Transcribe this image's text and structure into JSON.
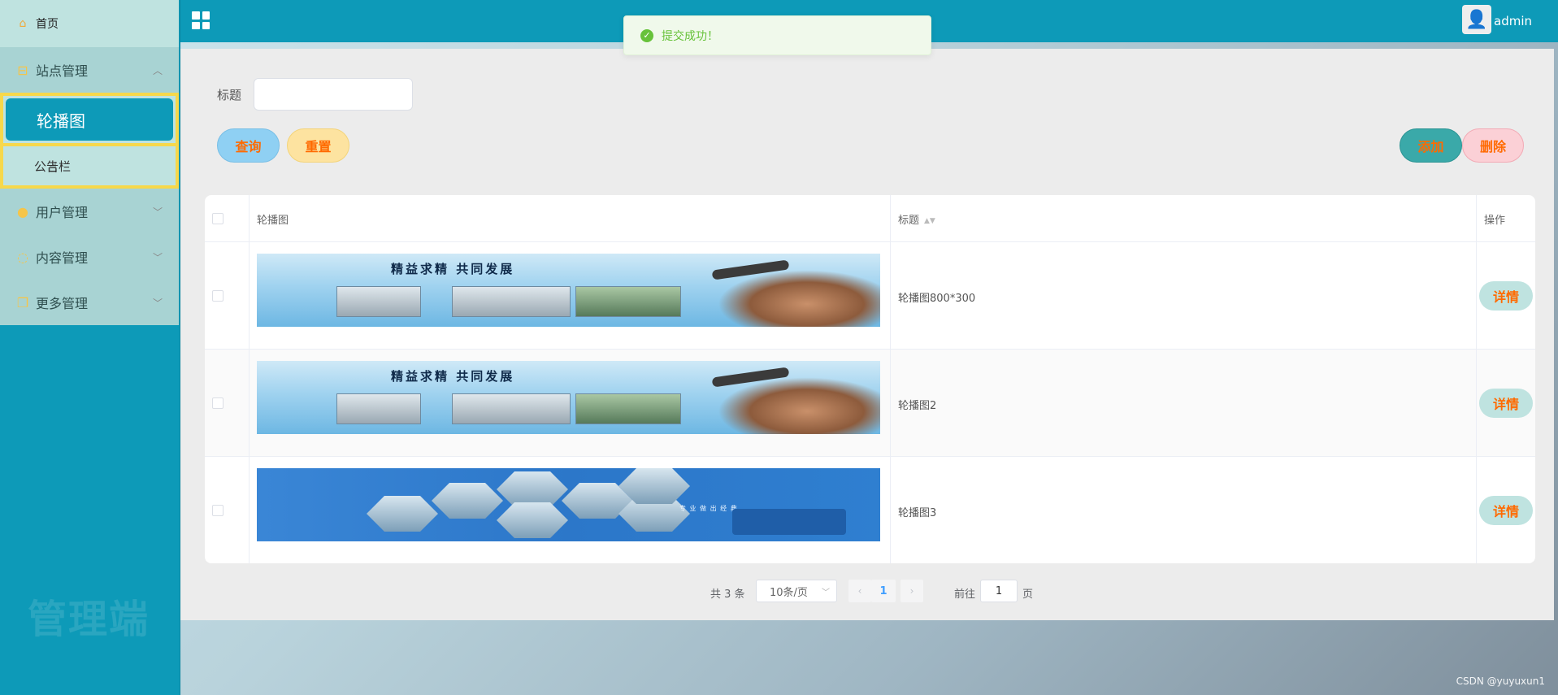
{
  "sidebar": {
    "home": "首页",
    "groups": [
      {
        "label": "站点管理",
        "expanded": true
      },
      {
        "label": "用户管理"
      },
      {
        "label": "内容管理"
      },
      {
        "label": "更多管理"
      }
    ],
    "sub_items": [
      {
        "label": "轮播图",
        "active": true
      },
      {
        "label": "公告栏"
      }
    ],
    "watermark": "管理端"
  },
  "header": {
    "title": "",
    "username": "admin"
  },
  "toast": {
    "message": "提交成功！"
  },
  "search": {
    "label": "标题",
    "value": "",
    "query_label": "查询",
    "reset_label": "重置"
  },
  "actions": {
    "add_label": "添加",
    "delete_label": "删除"
  },
  "table": {
    "columns": [
      "轮播图",
      "标题",
      "操作"
    ],
    "rows": [
      {
        "title": "轮播图800*300",
        "action": "详情",
        "banner_text": "精益求精 共同发展"
      },
      {
        "title": "轮播图2",
        "action": "详情",
        "banner_text": "精益求精 共同发展"
      },
      {
        "title": "轮播图3",
        "action": "详情",
        "banner_text": "专 业 做 出 经 典"
      }
    ]
  },
  "pagination": {
    "total": "共 3 条",
    "page_size": "10条/页",
    "current_page": "1",
    "goto_label": "前往",
    "goto_value": "1",
    "page_suffix": "页"
  },
  "footer": {
    "credit": "CSDN @yuyuxun1"
  },
  "colors": {
    "primary": "#0d9ab8",
    "highlight_border": "#f6d84b",
    "action_text": "#ff6a00"
  }
}
